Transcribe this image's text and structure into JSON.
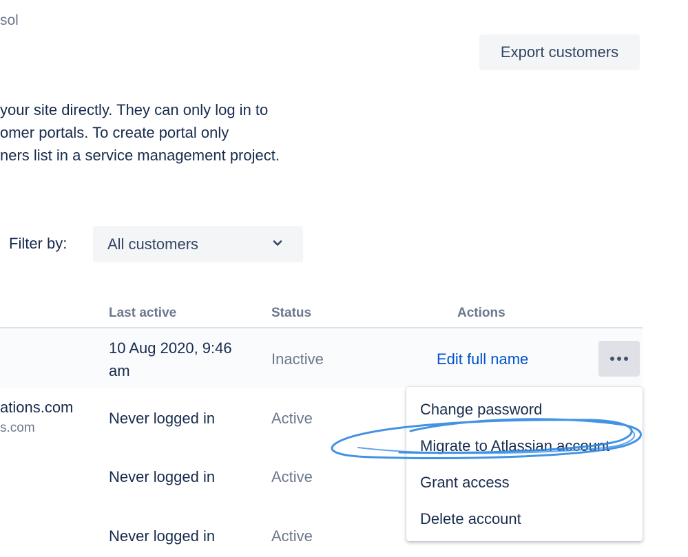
{
  "header": {
    "crumb_text": "sol",
    "export_label": "Export customers"
  },
  "description": {
    "lines": [
      "your site directly. They can only log in to",
      "omer portals. To create portal only",
      "ners list in a service management project."
    ]
  },
  "filter": {
    "label": "Filter by:",
    "selected": "All customers"
  },
  "table": {
    "columns": {
      "last_active": "Last active",
      "status": "Status",
      "actions": "Actions"
    },
    "rows": [
      {
        "last_active_line1": "10 Aug 2020, 9:46",
        "last_active_line2": "am",
        "status": "Inactive",
        "action_link": "Edit full name"
      },
      {
        "email_primary": "ations.com",
        "email_secondary": "s.com",
        "last_active": "Never logged in",
        "status": "Active"
      },
      {
        "last_active": "Never logged in",
        "status": "Active"
      },
      {
        "last_active": "Never logged in",
        "status": "Active"
      }
    ]
  },
  "actions_menu": {
    "items": [
      "Change password",
      "Migrate to Atlassian account",
      "Grant access",
      "Delete account"
    ]
  },
  "icons": {
    "filter_chevron": "chevron-down-icon",
    "more": "more-horizontal-icon"
  },
  "colors": {
    "link": "#0052cc",
    "annotation": "#2f86e0",
    "button_bg": "#f4f5f7"
  }
}
